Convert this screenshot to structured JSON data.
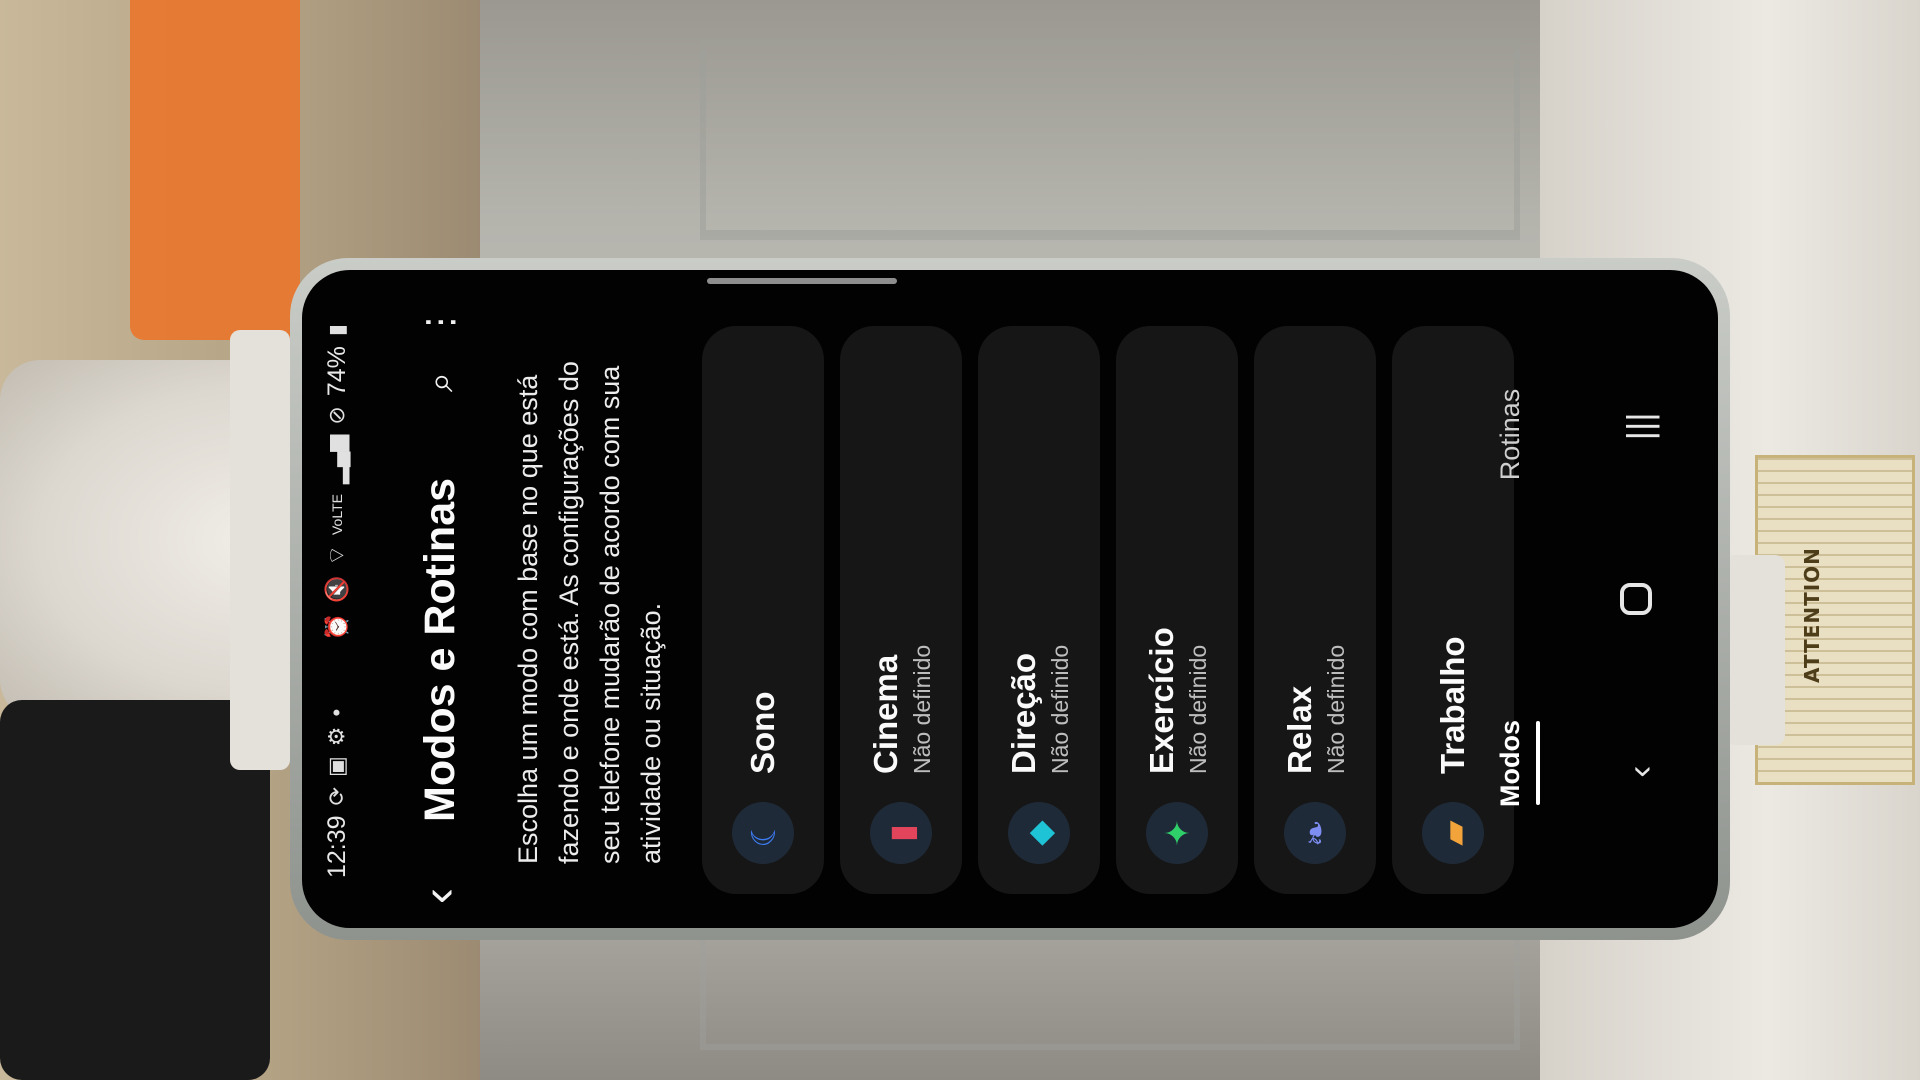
{
  "status_bar": {
    "time": "12:39",
    "battery": "74%",
    "signal_label": "VoLTE",
    "icons_left": [
      "sync-icon",
      "gallery-icon",
      "settings-gear-icon",
      "dot-icon"
    ],
    "icons_right": [
      "alarm-icon",
      "mute-icon",
      "wifi-icon",
      "signal-icon",
      "blocked-icon",
      "battery-icon"
    ]
  },
  "app_bar": {
    "title": "Modos e Rotinas",
    "back_icon": "back-chevron-icon",
    "search_icon": "search-icon",
    "more_icon": "more-options-icon"
  },
  "description": "Escolha um modo com base no que está fazendo e onde está. As configurações do seu telefone mudarão de acordo com sua atividade ou situação.",
  "modes": [
    {
      "name": "Sono",
      "status": "",
      "icon": "sleep-icon",
      "color": "#3d7bf2",
      "glyph": "☾"
    },
    {
      "name": "Cinema",
      "status": "Não definido",
      "icon": "cinema-icon",
      "color": "#e2455b",
      "glyph": "▮"
    },
    {
      "name": "Direção",
      "status": "Não definido",
      "icon": "driving-icon",
      "color": "#1ec3d6",
      "glyph": "◆"
    },
    {
      "name": "Exercício",
      "status": "Não definido",
      "icon": "exercise-icon",
      "color": "#2fd06a",
      "glyph": "✦"
    },
    {
      "name": "Relax",
      "status": "Não definido",
      "icon": "relax-leaf-icon",
      "color": "#7d8df2",
      "glyph": "❧"
    },
    {
      "name": "Trabalho",
      "status": "",
      "icon": "work-icon",
      "color": "#f2a33a",
      "glyph": "▰"
    }
  ],
  "tabs": [
    {
      "label": "Modos",
      "active": true
    },
    {
      "label": "Rotinas",
      "active": false
    }
  ],
  "nav_bar": {
    "back": "‹",
    "home": "home-icon",
    "recents": "|||"
  },
  "background": {
    "label_text": "ATTENTION"
  }
}
